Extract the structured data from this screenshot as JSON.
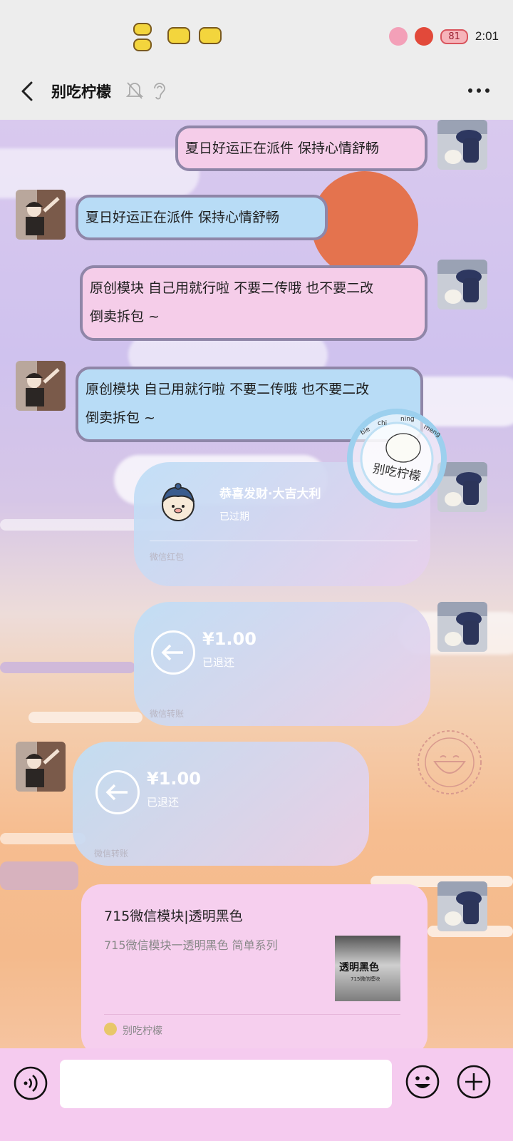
{
  "status_bar": {
    "battery": "81",
    "time": "2:01"
  },
  "header": {
    "title": "别吃柠檬"
  },
  "messages": {
    "m1_text": "夏日好运正在派件 保持心情舒畅",
    "m2_text": "夏日好运正在派件 保持心情舒畅",
    "m3_line1": "原创模块 自己用就行啦 不要二传哦 也不要二改",
    "m3_line2": "倒卖拆包 ~",
    "m4_line1": "原创模块 自己用就行啦 不要二传哦 也不要二改",
    "m4_line2": "倒卖拆包 ~"
  },
  "red_packet": {
    "title": "恭喜发财·大吉大利",
    "status": "已过期",
    "footer": "微信红包"
  },
  "transfer_1": {
    "amount": "¥1.00",
    "status": "已退还",
    "footer": "微信转账"
  },
  "transfer_2": {
    "amount": "¥1.00",
    "status": "已退还",
    "footer": "微信转账"
  },
  "share_card": {
    "title": "715微信模块|透明黑色",
    "description": "715微信模块一透明黑色 简单系列",
    "thumb_big": "透明黑色",
    "thumb_small": "715微信模块",
    "source": "别吃柠檬"
  },
  "stamp": {
    "pinyin": [
      "bie",
      "chi",
      "ning",
      "meng"
    ],
    "chars": "别吃柠檬"
  },
  "icons": {
    "back": "chevron-left-icon",
    "mute": "bell-off-icon",
    "ear": "ear-icon",
    "more": "more-dots-icon",
    "voice": "voice-icon",
    "emoji": "emoji-icon",
    "plus": "plus-circle-icon"
  },
  "colors": {
    "bubble_pink": "#f5cde9",
    "bubble_blue": "#b8dcf6",
    "bubble_border": "#8f86a8",
    "input_bar": "#f5cbef"
  }
}
